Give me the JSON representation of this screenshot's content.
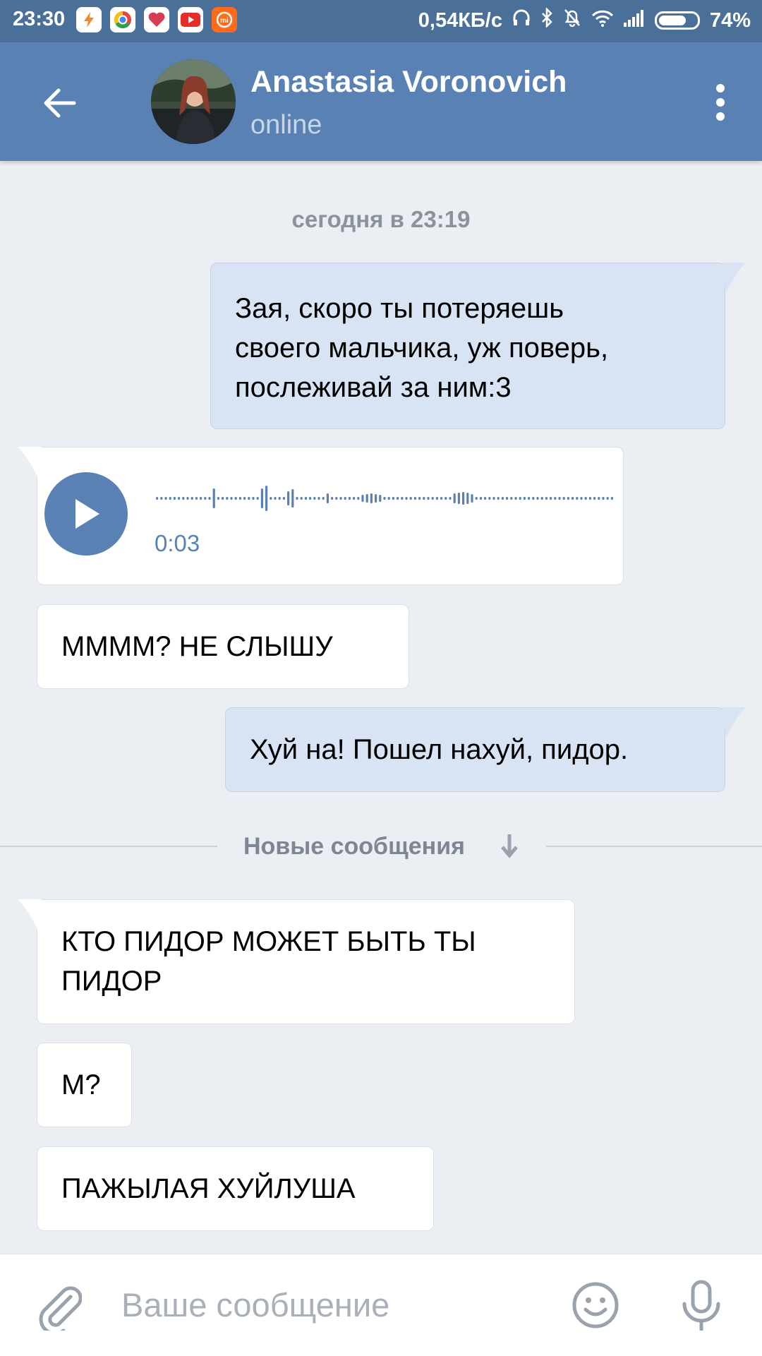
{
  "status_bar": {
    "time": "23:30",
    "speed": "0,54КБ/с",
    "battery": "74%",
    "battery_level": 0.74,
    "app_icons": [
      "flash-app-icon",
      "chrome-icon",
      "heart-app-icon",
      "youtube-icon",
      "mi-icon"
    ]
  },
  "header": {
    "name": "Anastasia Voronovich",
    "status": "online"
  },
  "chat": {
    "date_separator": "сегодня в 23:19",
    "new_messages_label": "Новые сообщения",
    "messages": [
      {
        "direction": "out",
        "lines": [
          "Зая, скоро ты потеряешь",
          "своего мальчика, уж поверь,",
          "послеживай за ним:3"
        ]
      },
      {
        "direction": "in",
        "type": "voice",
        "duration": "0:03"
      },
      {
        "direction": "in",
        "lines": [
          "ММММ? НЕ СЛЫШУ"
        ]
      },
      {
        "direction": "out",
        "lines": [
          "Хуй на! Пошел нахуй, пидор."
        ]
      },
      {
        "direction": "in",
        "lines": [
          "КТО ПИДОР МОЖЕТ БЫТЬ ТЫ",
          "ПИДОР"
        ]
      },
      {
        "direction": "in",
        "lines": [
          "М?"
        ]
      },
      {
        "direction": "in",
        "lines": [
          "ПАЖЫЛАЯ ХУЙЛУША"
        ]
      }
    ]
  },
  "composer": {
    "placeholder": "Ваше сообщение"
  },
  "colors": {
    "status_bar": "#4a6f99",
    "header": "#5a81b3",
    "background": "#ebeef2",
    "outgoing_bubble": "#d8e4f3",
    "incoming_bubble": "#ffffff",
    "accent": "#5a81b3"
  }
}
